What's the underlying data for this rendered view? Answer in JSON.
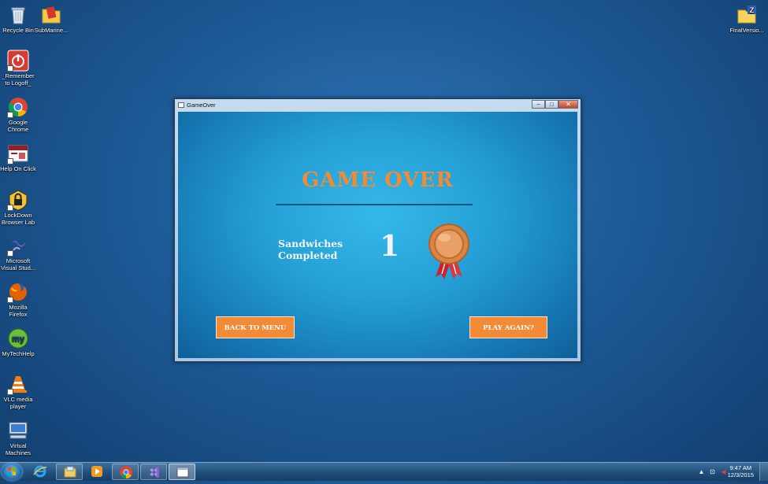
{
  "desktop": {
    "icons": [
      {
        "label": "Recycle Bin"
      },
      {
        "label": "SubMarine..."
      },
      {
        "label": "_Remember to Logoff_"
      },
      {
        "label": "Google Chrome"
      },
      {
        "label": "Help On Click"
      },
      {
        "label": "LockDown Browser Lab"
      },
      {
        "label": "Microsoft Visual Stud..."
      },
      {
        "label": "Mozilla Firefox"
      },
      {
        "label": "MyTechHelp"
      },
      {
        "label": "VLC media player"
      },
      {
        "label": "Virtual Machines"
      },
      {
        "label": "FinalVersio..."
      }
    ]
  },
  "window": {
    "title": "GameOver",
    "game_title": "GAME OVER",
    "score_label_line1": "Sandwiches",
    "score_label_line2": "Completed",
    "score_value": "1",
    "medal": "bronze-medal-icon",
    "back_button": "BACK TO MENU",
    "play_again_button": "PLAY AGAIN?"
  },
  "taskbar": {
    "items": [
      "internet-explorer-icon",
      "file-explorer-icon",
      "media-player-icon",
      "chrome-icon",
      "visual-studio-icon",
      "gameover-window-icon"
    ],
    "time": "9:47 AM",
    "date": "12/3/2015"
  },
  "colors": {
    "accent_orange": "#f28a36",
    "game_background": "#239fd5",
    "desktop_background": "#1d5a97"
  }
}
